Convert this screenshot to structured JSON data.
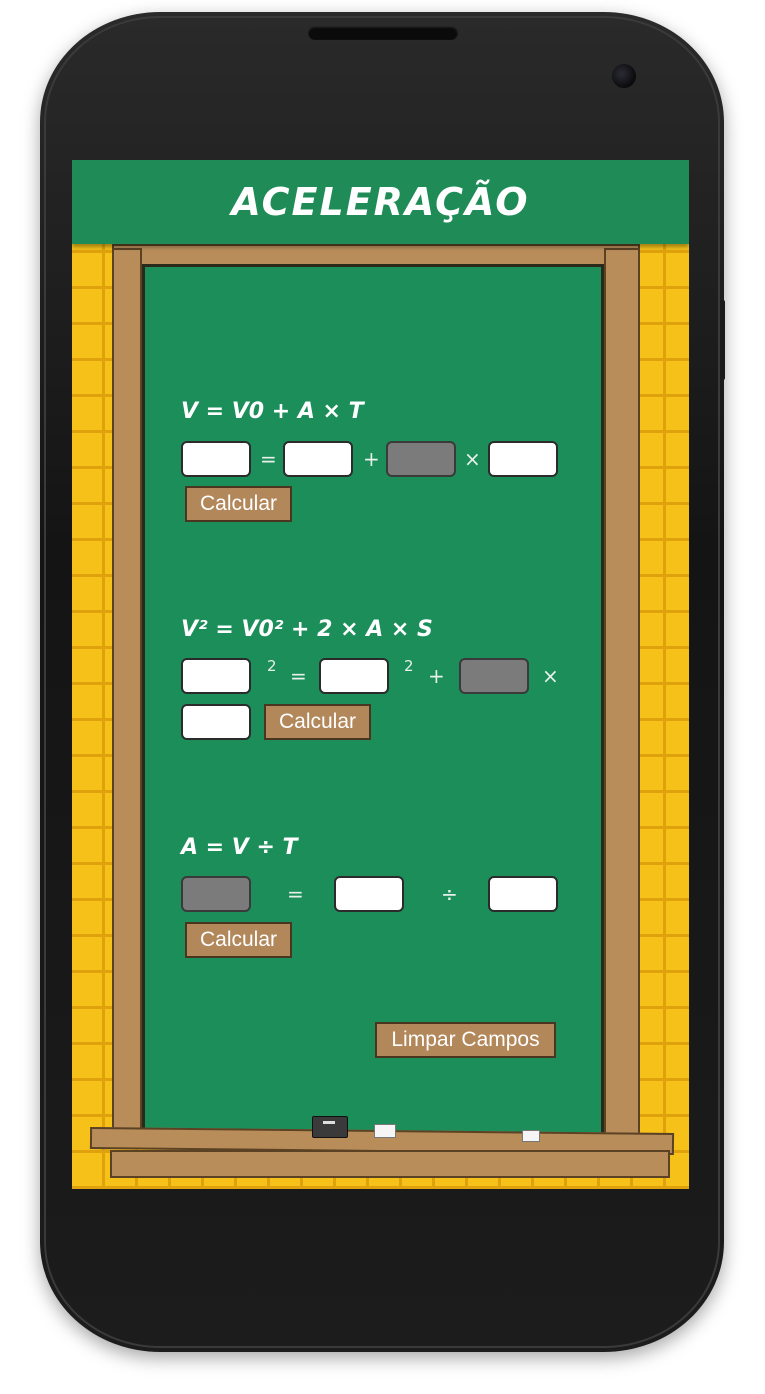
{
  "app": {
    "title": "ACELERAÇÃO",
    "brand_color": "#1f8c57"
  },
  "equations": [
    {
      "formula": "V = V0 + A × T",
      "operators": [
        "=",
        "+",
        "×"
      ],
      "fields": [
        {
          "name": "v",
          "value": "",
          "placeholder": ""
        },
        {
          "name": "v0",
          "value": "",
          "placeholder": ""
        },
        {
          "name": "a",
          "value": "",
          "placeholder": ""
        },
        {
          "name": "t",
          "value": "",
          "placeholder": ""
        }
      ],
      "button": "Calcular"
    },
    {
      "formula": "V² = V0² + 2 × A × S",
      "operators": [
        "2",
        "=",
        "2",
        "+",
        "×"
      ],
      "fields": [
        {
          "name": "v",
          "value": "",
          "placeholder": ""
        },
        {
          "name": "v0",
          "value": "",
          "placeholder": ""
        },
        {
          "name": "a",
          "value": "",
          "placeholder": ""
        },
        {
          "name": "s",
          "value": "",
          "placeholder": ""
        }
      ],
      "button": "Calcular"
    },
    {
      "formula": "A = V ÷ T",
      "operators": [
        "=",
        "÷"
      ],
      "fields": [
        {
          "name": "a",
          "value": "",
          "placeholder": ""
        },
        {
          "name": "v",
          "value": "",
          "placeholder": ""
        },
        {
          "name": "t",
          "value": "",
          "placeholder": ""
        }
      ],
      "button": "Calcular"
    }
  ],
  "clear_button": "Limpar Campos",
  "icons": [
    "eraser-icon",
    "chalk-icon"
  ]
}
